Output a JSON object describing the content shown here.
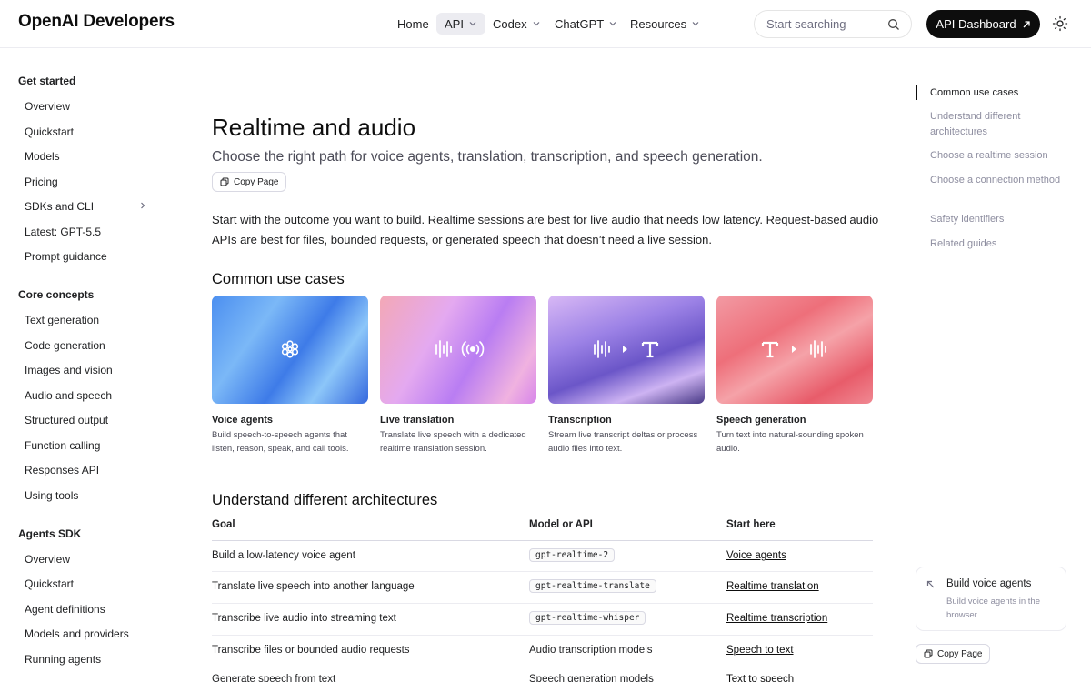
{
  "header": {
    "logo": "OpenAI Developers",
    "nav": [
      {
        "label": "Home"
      },
      {
        "label": "API"
      },
      {
        "label": "Codex"
      },
      {
        "label": "ChatGPT"
      },
      {
        "label": "Resources"
      }
    ],
    "search_placeholder": "Start searching",
    "dashboard_label": "API Dashboard"
  },
  "sidebar": {
    "sections": [
      {
        "title": "Get started",
        "items": [
          "Overview",
          "Quickstart",
          "Models",
          "Pricing",
          "SDKs and CLI",
          "Latest: GPT-5.5",
          "Prompt guidance"
        ]
      },
      {
        "title": "Core concepts",
        "items": [
          "Text generation",
          "Code generation",
          "Images and vision",
          "Audio and speech",
          "Structured output",
          "Function calling",
          "Responses API",
          "Using tools"
        ]
      },
      {
        "title": "Agents SDK",
        "items": [
          "Overview",
          "Quickstart",
          "Agent definitions",
          "Models and providers",
          "Running agents"
        ]
      }
    ]
  },
  "main": {
    "title": "Realtime and audio",
    "subtitle": "Choose the right path for voice agents, translation, transcription, and speech generation.",
    "copy_label": "Copy Page",
    "intro": "Start with the outcome you want to build. Realtime sessions are best for live audio that needs low latency. Request-based audio APIs are best for files, bounded requests, or generated speech that doesn’t need a live session.",
    "use_cases_heading": "Common use cases",
    "cards": [
      {
        "title": "Voice agents",
        "desc": "Build speech-to-speech agents that listen, reason, speak, and call tools."
      },
      {
        "title": "Live translation",
        "desc": "Translate live speech with a dedicated realtime translation session."
      },
      {
        "title": "Transcription",
        "desc": "Stream live transcript deltas or process audio files into text."
      },
      {
        "title": "Speech generation",
        "desc": "Turn text into natural-sounding spoken audio."
      }
    ],
    "arch_heading": "Understand different architectures",
    "table": {
      "headers": [
        "Goal",
        "Model or API",
        "Start here"
      ],
      "rows": [
        {
          "goal": "Build a low-latency voice agent",
          "model": "gpt-realtime-2",
          "link": "Voice agents"
        },
        {
          "goal": "Translate live speech into another language",
          "model": "gpt-realtime-translate",
          "link": "Realtime translation"
        },
        {
          "goal": "Transcribe live audio into streaming text",
          "model": "gpt-realtime-whisper",
          "link": "Realtime transcription"
        },
        {
          "goal": "Transcribe files or bounded audio requests",
          "model": "Audio transcription models",
          "link": "Speech to text"
        },
        {
          "goal": "Generate speech from text",
          "model": "Speech generation models",
          "link": "Text to speech"
        }
      ]
    }
  },
  "toc": {
    "items": [
      "Common use cases",
      "Understand different architectures",
      "Choose a realtime session",
      "Choose a connection method",
      "Safety identifiers",
      "Related guides"
    ]
  },
  "related_card": {
    "title": "Build voice agents",
    "desc": "Build voice agents in the browser.",
    "copy_label": "Copy Page"
  }
}
